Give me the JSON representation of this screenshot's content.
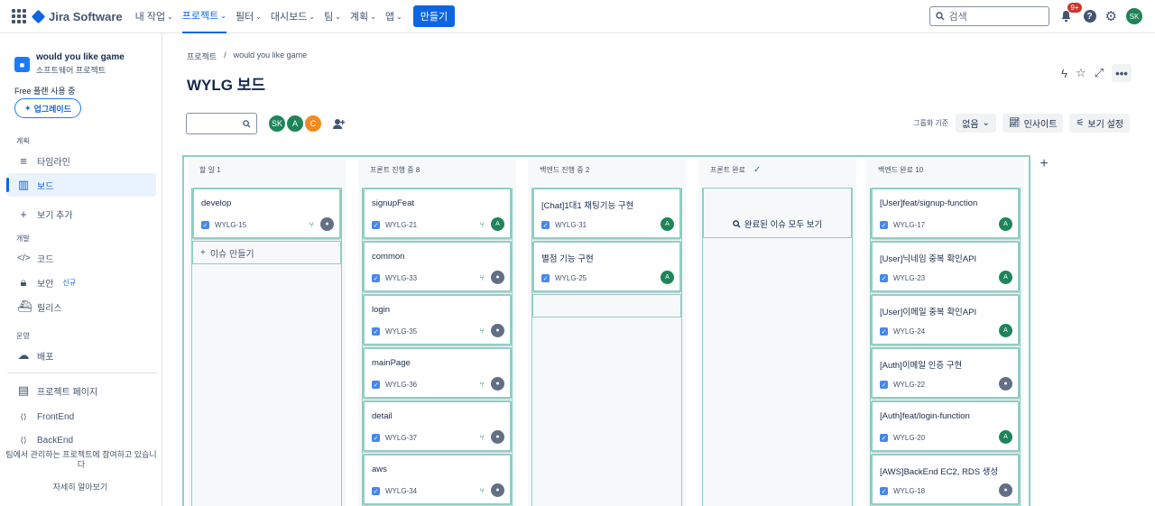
{
  "topnav": {
    "brand": "Jira Software",
    "items": [
      {
        "label": "내 작업",
        "active": false
      },
      {
        "label": "프로젝트",
        "active": true
      },
      {
        "label": "필터",
        "active": false
      },
      {
        "label": "대시보드",
        "active": false
      },
      {
        "label": "팀",
        "active": false
      },
      {
        "label": "계획",
        "active": false
      },
      {
        "label": "앱",
        "active": false
      }
    ],
    "create": "만들기",
    "search_placeholder": "검색",
    "notif_badge": "9+",
    "user_initials": "SK"
  },
  "sidebar": {
    "project_name": "would you like game",
    "project_type": "소프트웨어 프로젝트",
    "plan": "Free 플랜 사용 중",
    "upgrade": "업그레이드",
    "sections": {
      "plan": "계획",
      "dev": "개발",
      "ops": "운영"
    },
    "items": {
      "timeline": "타임라인",
      "board": "보드",
      "add_view": "보기 추가",
      "code": "코드",
      "security": "보안",
      "security_tag": "신규",
      "releases": "릴리스",
      "deploy": "배포",
      "project_page": "프로젝트 페이지",
      "frontend": "FrontEnd",
      "backend": "BackEnd"
    },
    "footer": "팀에서 관리하는 프로젝트에 참여하고 있습니다",
    "learn_more": "자세히 알아보기"
  },
  "header": {
    "breadcrumb": [
      "프로젝트",
      "would you like game"
    ],
    "title": "WYLG 보드"
  },
  "toolbar": {
    "avatars": [
      "SK",
      "A",
      "C"
    ],
    "group_by_label": "그룹화 기준",
    "group_by_value": "없음",
    "insights": "인사이트",
    "view_settings": "보기 설정"
  },
  "columns": [
    {
      "title": "할 일 1",
      "cards": [
        {
          "title": "develop",
          "key": "WYLG-15",
          "assignee": "",
          "avatar": "gray"
        }
      ],
      "create": "이슈 만들기"
    },
    {
      "title": "프론트 진행 중 8",
      "cards": [
        {
          "title": "signupFeat",
          "key": "WYLG-21",
          "assignee": "A",
          "avatar": "green"
        },
        {
          "title": "common",
          "key": "WYLG-33",
          "assignee": "",
          "avatar": "gray"
        },
        {
          "title": "login",
          "key": "WYLG-35",
          "assignee": "",
          "avatar": "gray"
        },
        {
          "title": "mainPage",
          "key": "WYLG-36",
          "assignee": "",
          "avatar": "gray"
        },
        {
          "title": "detail",
          "key": "WYLG-37",
          "assignee": "",
          "avatar": "gray"
        },
        {
          "title": "aws",
          "key": "WYLG-34",
          "assignee": "",
          "avatar": "gray"
        }
      ]
    },
    {
      "title": "백엔드 진행 중 2",
      "cards": [
        {
          "title": "[Chat]1대1 채팅기능 구현",
          "key": "WYLG-31",
          "assignee": "A",
          "avatar": "green"
        },
        {
          "title": "별점 기능 구현",
          "key": "WYLG-25",
          "assignee": "A",
          "avatar": "green"
        }
      ]
    },
    {
      "title": "프론트 완료",
      "cards": [],
      "view_all": "완료된 이슈 모두 보기"
    },
    {
      "title": "백엔드 완료 10",
      "cards": [
        {
          "title": "[User]feat/signup-function",
          "key": "WYLG-17",
          "assignee": "A",
          "avatar": "green"
        },
        {
          "title": "[User]닉네임 중복 확인API",
          "key": "WYLG-23",
          "assignee": "A",
          "avatar": "green"
        },
        {
          "title": "[User]이메일 중복 확인API",
          "key": "WYLG-24",
          "assignee": "A",
          "avatar": "green"
        },
        {
          "title": "[Auth]이메일 인증 구현",
          "key": "WYLG-22",
          "assignee": "",
          "avatar": "gray"
        },
        {
          "title": "[Auth]feat/login-function",
          "key": "WYLG-20",
          "assignee": "A",
          "avatar": "green"
        },
        {
          "title": "[AWS]BackEnd EC2, RDS 생성",
          "key": "WYLG-18",
          "assignee": "",
          "avatar": "gray"
        }
      ]
    }
  ],
  "colors": {
    "accent": "#0c66e4",
    "highlight": "#8fcfc4",
    "assignee_green": "#1f845a"
  }
}
